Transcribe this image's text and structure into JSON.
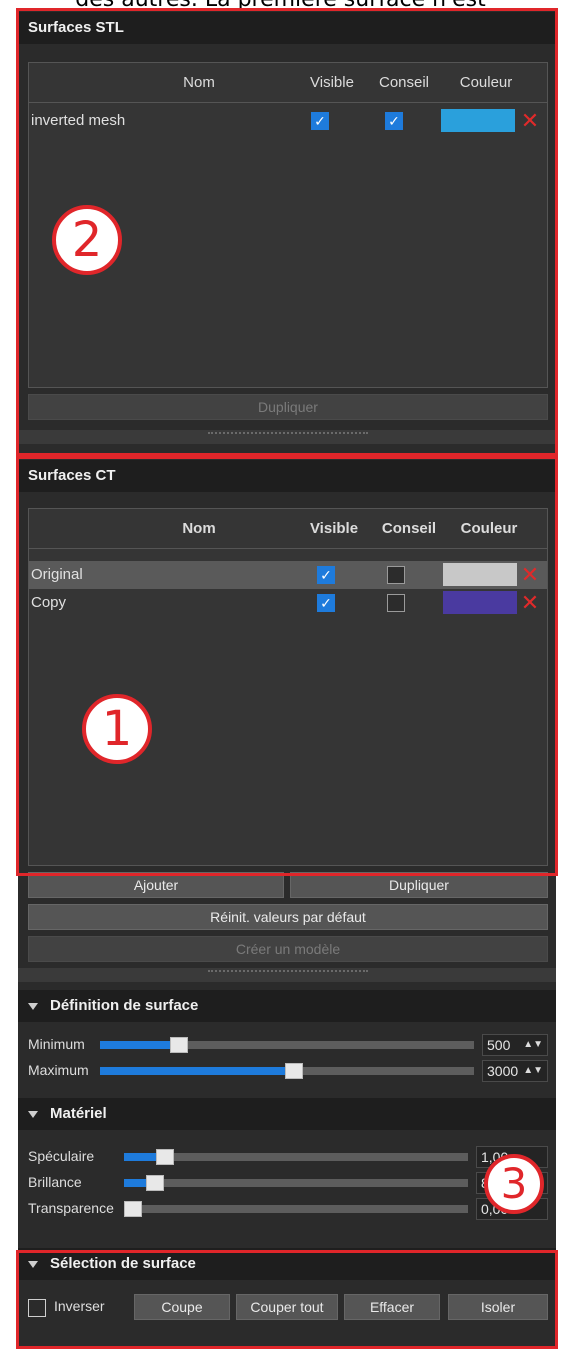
{
  "caption": "des autres. La première surface n'est",
  "stl": {
    "title": "Surfaces STL",
    "columns": {
      "name": "Nom",
      "visible": "Visible",
      "hint": "Conseil",
      "color": "Couleur"
    },
    "rows": [
      {
        "name": "inverted mesh",
        "visible": true,
        "hint": true,
        "color": "#2aa0dc"
      }
    ],
    "duplicate_label": "Dupliquer",
    "badge": "2"
  },
  "ct": {
    "title": "Surfaces CT",
    "columns": {
      "name": "Nom",
      "visible": "Visible",
      "hint": "Conseil",
      "color": "Couleur"
    },
    "rows": [
      {
        "name": "Original",
        "visible": true,
        "hint": false,
        "color": "#c8c8c8"
      },
      {
        "name": "Copy",
        "visible": true,
        "hint": false,
        "color": "#4a3aa0"
      }
    ],
    "add_label": "Ajouter",
    "duplicate_label": "Dupliquer",
    "reset_label": "Réinit. valeurs par défaut",
    "create_model_label": "Créer un modèle",
    "badge": "1"
  },
  "surface_definition": {
    "title": "Définition de surface",
    "minimum": {
      "label": "Minimum",
      "value": "500",
      "fraction": 0.21
    },
    "maximum": {
      "label": "Maximum",
      "value": "3000",
      "fraction": 0.52
    }
  },
  "material": {
    "title": "Matériel",
    "specular": {
      "label": "Spéculaire",
      "value": "1,00",
      "fraction": 0.12
    },
    "brightness": {
      "label": "Brillance",
      "value": "8",
      "fraction": 0.09
    },
    "transparency": {
      "label": "Transparence",
      "value": "0,00",
      "fraction": 0.0
    },
    "badge": "3"
  },
  "surface_selection": {
    "title": "Sélection de surface",
    "invert_label": "Inverser",
    "cut_label": "Coupe",
    "cut_all_label": "Couper tout",
    "erase_label": "Effacer",
    "isolate_label": "Isoler"
  },
  "colors": {
    "accent": "#1e7bdc",
    "highlight": "#e0262a",
    "panel": "#2b2b2b"
  }
}
